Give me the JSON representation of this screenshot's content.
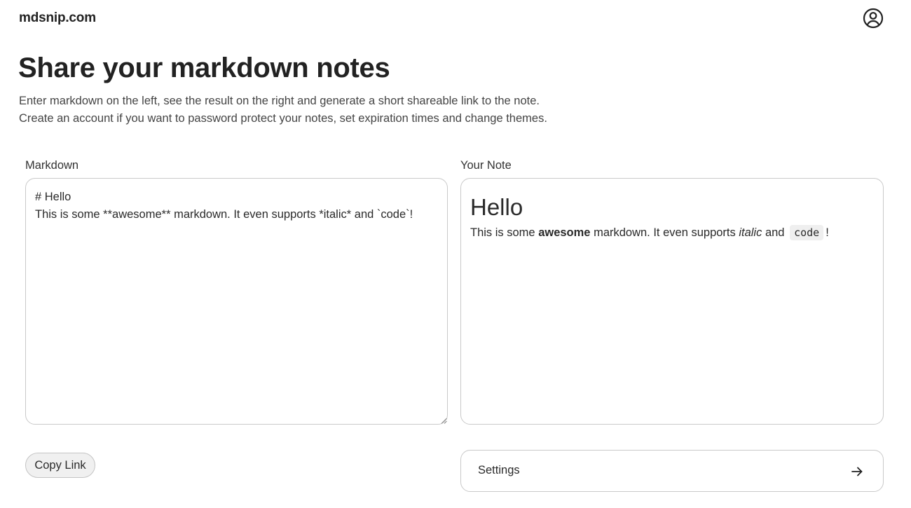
{
  "header": {
    "brand": "mdsnip.com",
    "account_icon": "user-circle-icon"
  },
  "hero": {
    "title": "Share your markdown notes",
    "description_line1": "Enter markdown on the left, see the result on the right and generate a short shareable link to the note.",
    "description_line2": "Create an account if you want to password protect your notes, set expiration times and change themes."
  },
  "editor": {
    "label": "Markdown",
    "lines": [
      "# Hello",
      "",
      "This is some **awesome** markdown. It even supports *italic* and `code`!"
    ]
  },
  "preview": {
    "label": "Your Note",
    "heading": "Hello",
    "paragraph": {
      "part1": "This is some ",
      "bold": "awesome",
      "part2": " markdown. It even supports ",
      "italic": "italic",
      "part3": " and ",
      "code": "code",
      "part4": "!"
    }
  },
  "actions": {
    "copy_link_label": "Copy Link",
    "settings_label": "Settings",
    "settings_icon": "arrow-right-icon"
  },
  "colors": {
    "text": "#2a2a2a",
    "border": "#c9c9c9",
    "button_bg": "#f0f0f0",
    "code_bg": "#efefef"
  }
}
